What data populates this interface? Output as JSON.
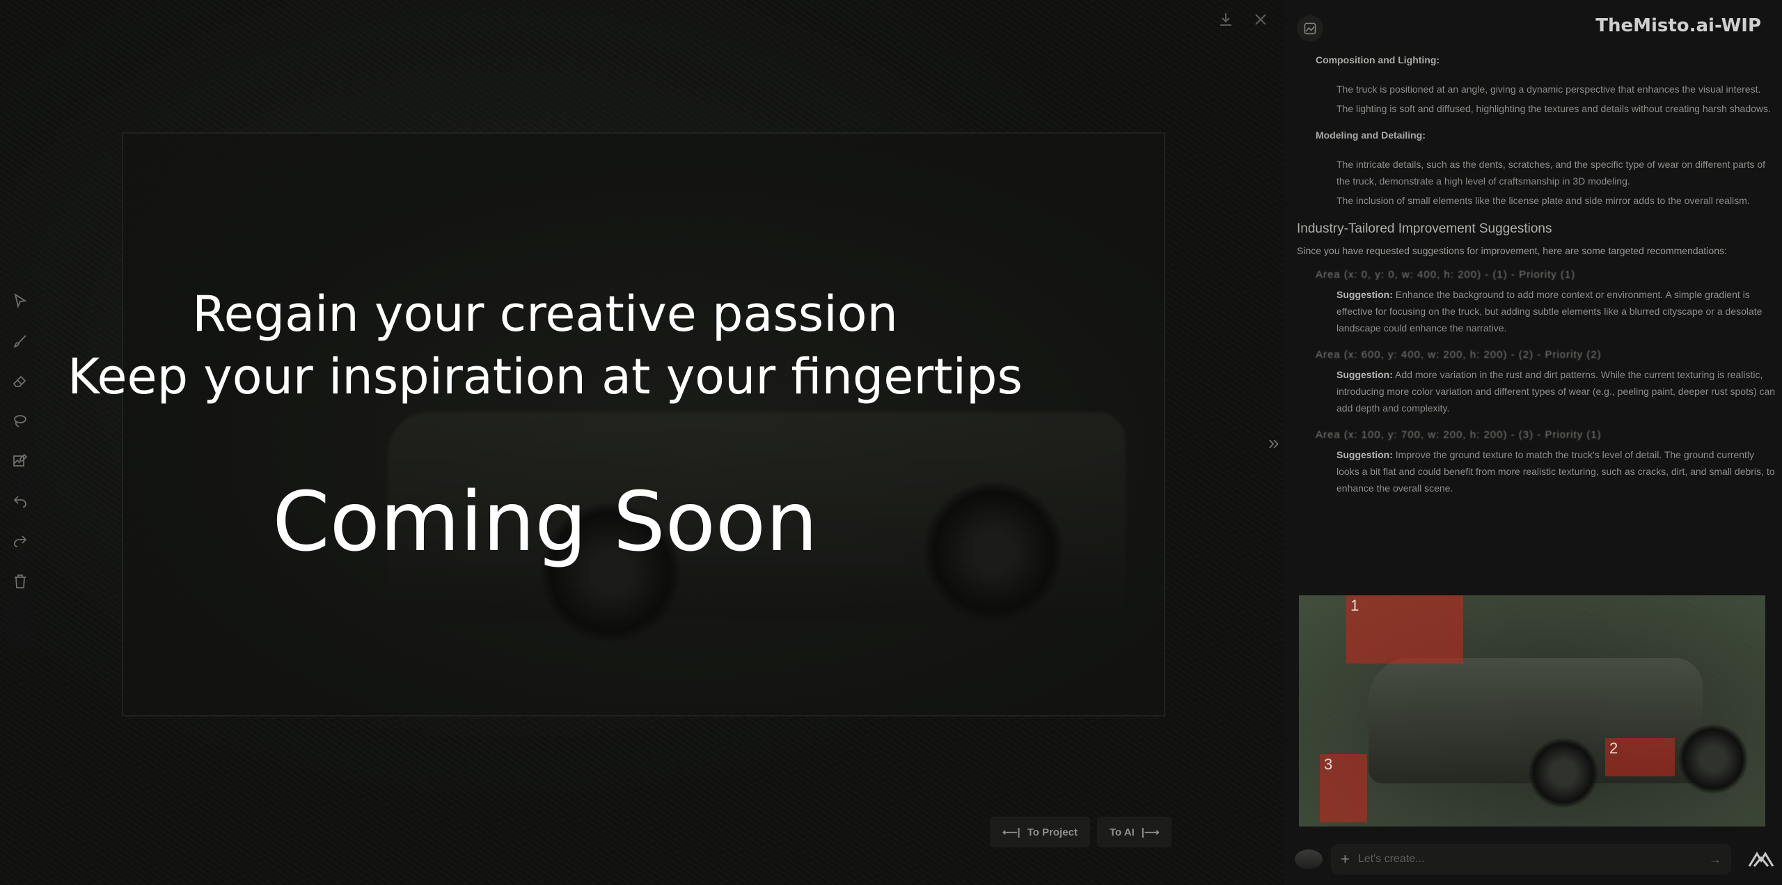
{
  "brand": "TheMisto.ai-WIP",
  "overlay": {
    "tagline1": "Regain your creative passion",
    "tagline2": "Keep your inspiration at your fingertips",
    "coming_soon": "Coming Soon"
  },
  "nav": {
    "to_project": "To Project",
    "to_ai": "To AI"
  },
  "analysis": {
    "sections": [
      {
        "title": "Composition and Lighting:",
        "bullets": [
          "The truck is positioned at an angle, giving a dynamic perspective that enhances the visual interest.",
          "The lighting is soft and diffused, highlighting the textures and details without creating harsh shadows."
        ]
      },
      {
        "title": "Modeling and Detailing:",
        "bullets": [
          "The intricate details, such as the dents, scratches, and the specific type of wear on different parts of the truck, demonstrate a high level of craftsmanship in 3D modeling.",
          "The inclusion of small elements like the license plate and side mirror adds to the overall realism."
        ]
      }
    ],
    "suggestions_heading": "Industry-Tailored Improvement Suggestions",
    "suggestions_intro": "Since you have requested suggestions for improvement, here are some targeted recommendations:",
    "suggestions": [
      {
        "box": "Area (x: 0, y: 0, w: 400, h: 200) - (1) - Priority (1)",
        "label": "Suggestion:",
        "text": "Enhance the background to add more context or environment. A simple gradient is effective for focusing on the truck, but adding subtle elements like a blurred cityscape or a desolate landscape could enhance the narrative."
      },
      {
        "box": "Area (x: 600, y: 400, w: 200, h: 200) - (2) - Priority (2)",
        "label": "Suggestion:",
        "text": "Add more variation in the rust and dirt patterns. While the current texturing is realistic, introducing more color variation and different types of wear (e.g., peeling paint, deeper rust spots) can add depth and complexity."
      },
      {
        "box": "Area (x: 100, y: 700, w: 200, h: 200) - (3) - Priority (1)",
        "label": "Suggestion:",
        "text": "Improve the ground texture to match the truck's level of detail. The ground currently looks a bit flat and could benefit from more realistic texturing, such as cracks, dirt, and small debris, to enhance the overall scene."
      }
    ]
  },
  "preview": {
    "regions": [
      "1",
      "2",
      "3"
    ]
  },
  "prompt": {
    "placeholder": "Let's create..."
  },
  "colors": {
    "region": "#c8281e",
    "overlay_text": "#ffffff",
    "panel_bg": "#121312"
  },
  "icons": {
    "toolbar": [
      "cursor-icon",
      "brush-icon",
      "eraser-icon",
      "lasso-icon",
      "image-edit-icon",
      "undo-icon",
      "redo-icon",
      "trash-icon"
    ],
    "top": [
      "download-icon",
      "close-icon"
    ]
  }
}
